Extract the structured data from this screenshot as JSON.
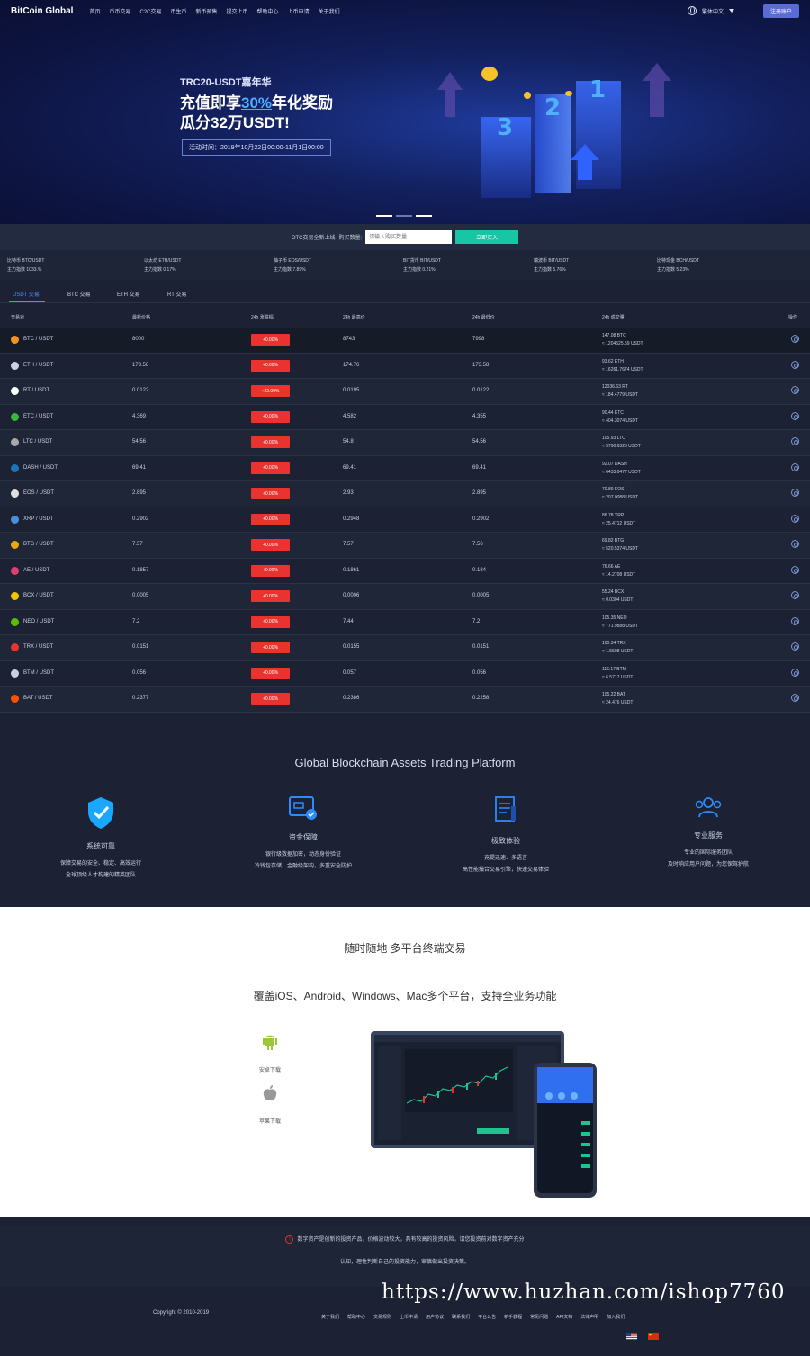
{
  "header": {
    "logo": "BitCoin Global",
    "nav": [
      "首页",
      "币币交易",
      "C2C交易",
      "币生币",
      "新币预售",
      "提交上币",
      "帮助中心",
      "上币申请",
      "关于我们"
    ],
    "lang": "繁体中文",
    "register": "注册账户"
  },
  "hero": {
    "subtitle": "TRC20-USDT嘉年华",
    "line1_pre": "充值即享",
    "line1_hl": "30%",
    "line1_post": "年化奖励",
    "line2": "瓜分32万USDT!",
    "time": "活动时间：2019年10月22日00:00-11月1日00:00"
  },
  "otc": {
    "label": "OTC交易全新上线",
    "label2": "购买数量:",
    "placeholder": "请输入购买数量",
    "button": "立即买入"
  },
  "ticker": [
    {
      "name": "比特币 BTC/USDT",
      "sub": "主力指数 1033.%"
    },
    {
      "name": "以太坊 ETH/USDT",
      "sub": "主力指数 0.17%"
    },
    {
      "name": "柚子币 EOS/USDT",
      "sub": "主力指数 7.89%"
    },
    {
      "name": "BIT货币 BIT/USDT",
      "sub": "主力指数 0.21%"
    },
    {
      "name": "瑞波币 BIT/USDT",
      "sub": "主力指数 5.76%"
    },
    {
      "name": "比特现金 BCH/USDT",
      "sub": "主力指数 5.23%"
    }
  ],
  "tabs": [
    "USDT 交易",
    "BTC 交易",
    "ETH 交易",
    "RT 交易"
  ],
  "table": {
    "headers": [
      "交易对",
      "最新价格",
      "24h 涨跌幅",
      "24h 最高价",
      "24h 最低价",
      "24h 成交量",
      "操作"
    ],
    "rows": [
      {
        "pair": "BTC / USDT",
        "price": "8000",
        "change": "+0.00%",
        "high": "8743",
        "low": "7998",
        "vol1": "147.08 BTC",
        "vol2": "≈ 1204525.59 USDT",
        "color": "#f7931a"
      },
      {
        "pair": "ETH / USDT",
        "price": "173.58",
        "change": "+0.00%",
        "high": "174.76",
        "low": "173.58",
        "vol1": "93.62 ETH",
        "vol2": "≈ 16261.7674 USDT",
        "color": "#c9d1e3"
      },
      {
        "pair": "RT / USDT",
        "price": "0.0122",
        "change": "+22.00%",
        "high": "0.0195",
        "low": "0.0122",
        "vol1": "12036.63 RT",
        "vol2": "≈ 184.4779 USDT",
        "color": "#ffffff"
      },
      {
        "pair": "ETC / USDT",
        "price": "4.369",
        "change": "+0.00%",
        "high": "4.582",
        "low": "4.355",
        "vol1": "90.44 ETC",
        "vol2": "≈ 404.3074 USDT",
        "color": "#3ab83a"
      },
      {
        "pair": "LTC / USDT",
        "price": "54.56",
        "change": "+0.00%",
        "high": "54.8",
        "low": "54.56",
        "vol1": "105.93 LTC",
        "vol2": "≈ 5790.6323 USDT",
        "color": "#a8a8a8"
      },
      {
        "pair": "DASH / USDT",
        "price": "69.41",
        "change": "+0.00%",
        "high": "69.41",
        "low": "69.41",
        "vol1": "92.07 DASH",
        "vol2": "≈ 6433.0477 USDT",
        "color": "#1c75bc"
      },
      {
        "pair": "EOS / USDT",
        "price": "2.895",
        "change": "+0.00%",
        "high": "2.93",
        "low": "2.895",
        "vol1": "70.89 EOS",
        "vol2": "≈ 207.0088 USDT",
        "color": "#e0e0e0"
      },
      {
        "pair": "XRP / USDT",
        "price": "0.2902",
        "change": "+0.00%",
        "high": "0.2948",
        "low": "0.2902",
        "vol1": "86.78 XRP",
        "vol2": "≈ 25.4712 USDT",
        "color": "#4a90d9"
      },
      {
        "pair": "BTG / USDT",
        "price": "7.57",
        "change": "+0.00%",
        "high": "7.57",
        "low": "7.56",
        "vol1": "69.82 BTG",
        "vol2": "≈ 520.5374 USDT",
        "color": "#eba809"
      },
      {
        "pair": "AE / USDT",
        "price": "0.1857",
        "change": "+0.00%",
        "high": "0.1861",
        "low": "0.184",
        "vol1": "76.66 AE",
        "vol2": "≈ 14.2708 USDT",
        "color": "#de3f6b"
      },
      {
        "pair": "BCX / USDT",
        "price": "0.0005",
        "change": "+0.00%",
        "high": "0.0006",
        "low": "0.0005",
        "vol1": "55.24 BCX",
        "vol2": "≈ 0.0304 USDT",
        "color": "#f2c500"
      },
      {
        "pair": "NEO / USDT",
        "price": "7.2",
        "change": "+0.00%",
        "high": "7.44",
        "low": "7.2",
        "vol1": "105.35 NEO",
        "vol2": "≈ 771.9888 USDT",
        "color": "#58bf00"
      },
      {
        "pair": "TRX / USDT",
        "price": "0.0151",
        "change": "+0.00%",
        "high": "0.0155",
        "low": "0.0151",
        "vol1": "100.34 TRX",
        "vol2": "≈ 1.5508 USDT",
        "color": "#e8332f"
      },
      {
        "pair": "BTM / USDT",
        "price": "0.056",
        "change": "+0.00%",
        "high": "0.057",
        "low": "0.056",
        "vol1": "116.17 BTM",
        "vol2": "≈ 6.5717 USDT",
        "color": "#c9d1e3"
      },
      {
        "pair": "BAT / USDT",
        "price": "0.2377",
        "change": "+0.00%",
        "high": "0.2386",
        "low": "0.2258",
        "vol1": "105.22 BAT",
        "vol2": "≈ 24.476 USDT",
        "color": "#ff5000"
      }
    ]
  },
  "features": {
    "title": "Global Blockchain Assets Trading Platform",
    "items": [
      {
        "name": "系统可靠",
        "d1": "保障交易的安全、稳定、高效运行",
        "d2": "全球顶级人才构建的精英团队"
      },
      {
        "name": "资金保障",
        "d1": "银行级数据加密，动态身份验证",
        "d2": "冷钱包存储，金融级架构，多重安全防护"
      },
      {
        "name": "极致体验",
        "d1": "充提迅速、多语言",
        "d2": "高性能撮合交易引擎，快速交易体验"
      },
      {
        "name": "专业服务",
        "d1": "专业的国际服务团队",
        "d2": "及时响应用户问题，为您保驾护航"
      }
    ]
  },
  "platform": {
    "title": "随时随地 多平台终端交易",
    "subtitle": "覆盖iOS、Android、Windows、Mac多个平台，支持全业务功能",
    "android": "安卓下载",
    "ios": "苹果下载"
  },
  "warning": {
    "line1": "数字资产是创新的投资产品，价格波动较大，具有较高的投资风险，请您投资前对数字资产充分",
    "line2": "认知，理性判断自己的投资能力，审慎做出投资决策。"
  },
  "footer": {
    "copyright": "Copyright © 2010-2019",
    "links": [
      "关于我们",
      "帮助中心",
      "交易规则",
      "上币申请",
      "用户协议",
      "联系我们",
      "平台公告",
      "新手教程",
      "常见问题",
      "API文档",
      "法律声明",
      "加入我们"
    ]
  },
  "watermark": "https://www.huzhan.com/ishop7760"
}
